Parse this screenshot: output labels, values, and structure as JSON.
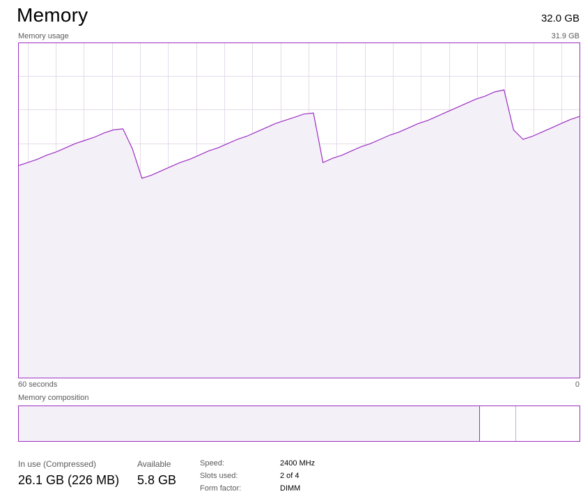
{
  "header": {
    "title": "Memory",
    "total": "32.0 GB"
  },
  "graph": {
    "label": "Memory usage",
    "max_label": "31.9 GB",
    "time_left": "60 seconds",
    "time_right": "0",
    "line_color": "#9b2ec2",
    "fill_color": "#f4f0f7",
    "grid_color": "#e3dbe8"
  },
  "chart_data": {
    "type": "area",
    "x": [
      0,
      1,
      2,
      3,
      4,
      5,
      6,
      7,
      8,
      9,
      10,
      11,
      12,
      13,
      14,
      15,
      16,
      17,
      18,
      19,
      20,
      21,
      22,
      23,
      24,
      25,
      26,
      27,
      28,
      29,
      30,
      31,
      32,
      33,
      34,
      35,
      36,
      37,
      38,
      39,
      40,
      41,
      42,
      43,
      44,
      45,
      46,
      47,
      48,
      49,
      50,
      51,
      52,
      53,
      54,
      55,
      56,
      57,
      58,
      59
    ],
    "values": [
      20.2,
      20.5,
      20.8,
      21.2,
      21.5,
      21.9,
      22.3,
      22.6,
      22.9,
      23.3,
      23.6,
      23.7,
      21.8,
      19.0,
      19.3,
      19.7,
      20.1,
      20.5,
      20.8,
      21.2,
      21.6,
      21.9,
      22.3,
      22.7,
      23.0,
      23.4,
      23.8,
      24.2,
      24.5,
      24.8,
      25.1,
      25.2,
      20.5,
      20.9,
      21.2,
      21.6,
      22.0,
      22.3,
      22.7,
      23.1,
      23.4,
      23.8,
      24.2,
      24.5,
      24.9,
      25.3,
      25.7,
      26.1,
      26.5,
      26.8,
      27.2,
      27.4,
      23.6,
      22.7,
      23.0,
      23.4,
      23.8,
      24.2,
      24.6,
      24.9
    ],
    "ylim": [
      0,
      31.9
    ],
    "xlim": [
      0,
      59
    ],
    "grid": true
  },
  "composition": {
    "label": "Memory composition",
    "in_use_fraction": 0.822,
    "modified_fraction": 0.065,
    "standby_fraction": 0.113
  },
  "stats": {
    "in_use_label": "In use (Compressed)",
    "in_use_value": "26.1 GB (226 MB)",
    "available_label": "Available",
    "available_value": "5.8 GB"
  },
  "details": {
    "speed_label": "Speed:",
    "speed_value": "2400 MHz",
    "slots_label": "Slots used:",
    "slots_value": "2 of 4",
    "form_label": "Form factor:",
    "form_value": "DIMM"
  }
}
